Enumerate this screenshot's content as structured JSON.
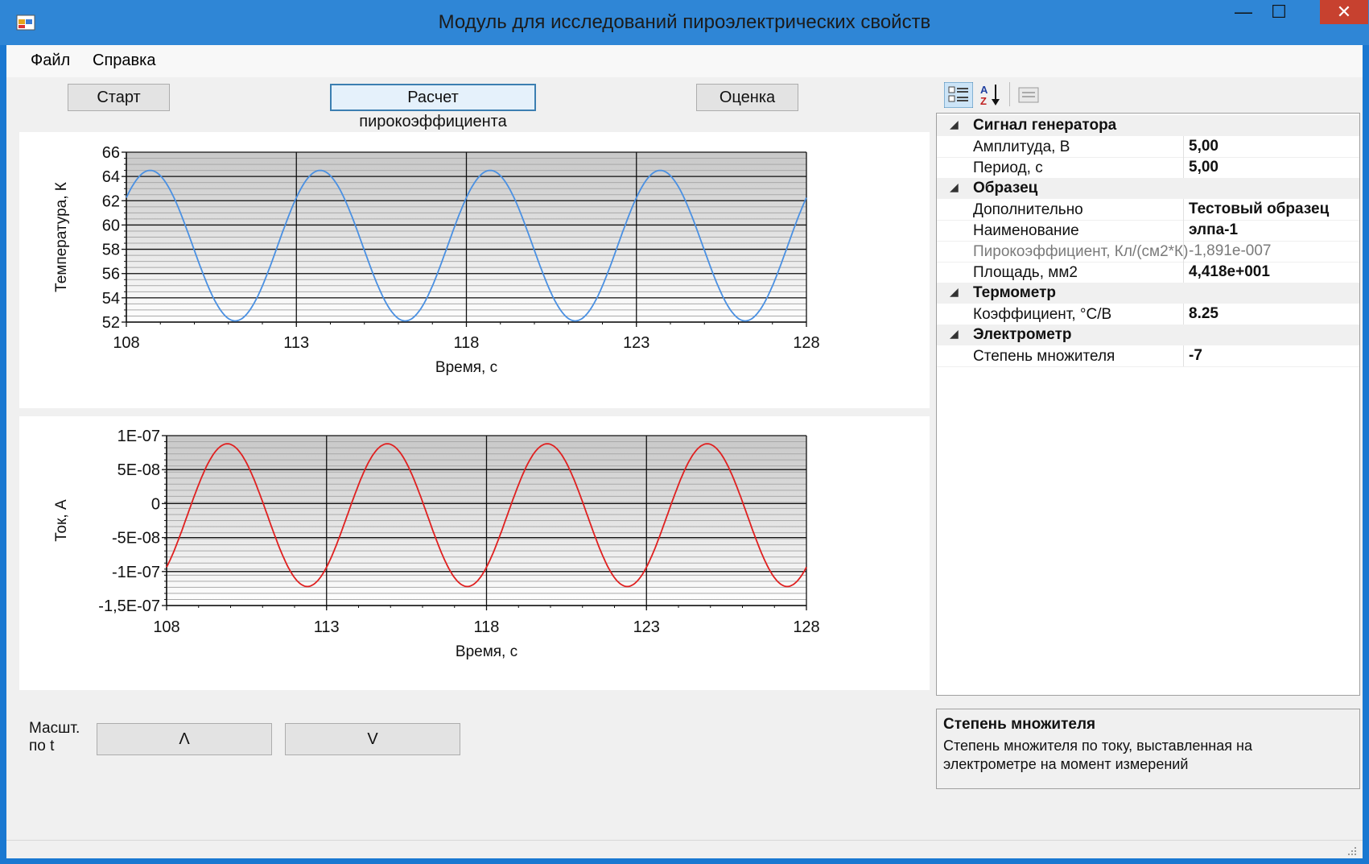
{
  "window": {
    "title": "Модуль для исследований пироэлектрических свойств"
  },
  "menu": [
    "Файл",
    "Справка"
  ],
  "buttons": {
    "start": "Старт",
    "calc": "Расчет пирокоэффициента",
    "estimate": "Оценка"
  },
  "zoom": {
    "label_line1": "Масшт.",
    "label_line2": "по t",
    "up": "Λ",
    "down": "V"
  },
  "chart_data": [
    {
      "type": "line",
      "xlabel": "Время, с",
      "ylabel": "Температура, К",
      "xlim": [
        108,
        128
      ],
      "ylim": [
        52,
        66
      ],
      "xticks": [
        "108",
        "113",
        "118",
        "123",
        "128"
      ],
      "yticks": [
        "52",
        "54",
        "56",
        "58",
        "60",
        "62",
        "64",
        "66"
      ],
      "color": "#4a90e2",
      "series": [
        {
          "name": "",
          "model": "sine",
          "period": 5,
          "mean": 58.3,
          "amplitude": 6.2,
          "peak_at": 108.7
        }
      ]
    },
    {
      "type": "line",
      "xlabel": "Время, с",
      "ylabel": "Ток, А",
      "xlim": [
        108,
        128
      ],
      "ylim": [
        -1.5e-07,
        1e-07
      ],
      "xticks": [
        "108",
        "113",
        "118",
        "123",
        "128"
      ],
      "yticks": [
        "1E-07",
        "5E-08",
        "0",
        "-5E-08",
        "-1E-07",
        "-1,5E-07"
      ],
      "ytick_values": [
        1e-07,
        5e-08,
        0,
        -5e-08,
        -1e-07,
        -1.5e-07
      ],
      "color": "#e02020",
      "series": [
        {
          "name": "",
          "model": "sine",
          "period": 5,
          "mean": -1.7e-08,
          "amplitude": 1.05e-07,
          "peak_at": 109.9
        }
      ]
    }
  ],
  "propgrid": {
    "rows": [
      {
        "kind": "cat",
        "label": "Сигнал генератора"
      },
      {
        "kind": "prop",
        "label": "Амплитуда, В",
        "value": "5,00"
      },
      {
        "kind": "prop",
        "label": "Период, с",
        "value": "5,00"
      },
      {
        "kind": "cat",
        "label": "Образец"
      },
      {
        "kind": "prop",
        "label": "Дополнительно",
        "value": "Тестовый образец"
      },
      {
        "kind": "prop",
        "label": "Наименование",
        "value": "элпа-1"
      },
      {
        "kind": "prop",
        "label": "Пирокоэффициент, Кл/(см2*К)",
        "value": "-1,891e-007",
        "readonly": true
      },
      {
        "kind": "prop",
        "label": "Площадь, мм2",
        "value": "4,418e+001"
      },
      {
        "kind": "cat",
        "label": "Термометр"
      },
      {
        "kind": "prop",
        "label": "Коэффициент, °С/В",
        "value": "8.25"
      },
      {
        "kind": "cat",
        "label": "Электрометр"
      },
      {
        "kind": "prop",
        "label": "Степень множителя",
        "value": "-7"
      }
    ],
    "help_title": "Степень множителя",
    "help_desc": "Степень множителя по току, выставленная на электрометре на момент измерений"
  }
}
